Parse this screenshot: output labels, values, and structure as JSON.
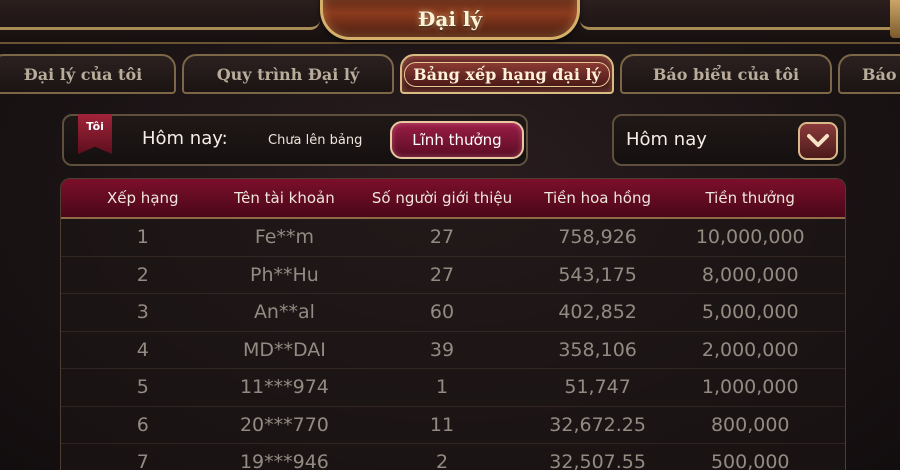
{
  "header": {
    "title": "Đại lý"
  },
  "tabs": [
    {
      "label": "Đại lý của tôi",
      "active": false
    },
    {
      "label": "Quy trình Đại lý",
      "active": false
    },
    {
      "label": "Bảng xếp hạng đại lý",
      "active": true
    },
    {
      "label": "Báo biểu của tôi",
      "active": false
    },
    {
      "label": "Báo",
      "active": false
    }
  ],
  "filter": {
    "badge": "Tôi",
    "today_label": "Hôm nay:",
    "status_text": "Chưa lên bảng",
    "claim_button": "Lĩnh thưởng",
    "period_select": "Hôm nay"
  },
  "table": {
    "headers": [
      "Xếp hạng",
      "Tên tài khoản",
      "Số người giới thiệu",
      "Tiền hoa hồng",
      "Tiền thưởng"
    ],
    "rows": [
      [
        "1",
        "Fe**m",
        "27",
        "758,926",
        "10,000,000"
      ],
      [
        "2",
        "Ph**Hu",
        "27",
        "543,175",
        "8,000,000"
      ],
      [
        "3",
        "An**al",
        "60",
        "402,852",
        "5,000,000"
      ],
      [
        "4",
        "MD**DAI",
        "39",
        "358,106",
        "2,000,000"
      ],
      [
        "5",
        "11***974",
        "1",
        "51,747",
        "1,000,000"
      ],
      [
        "6",
        "20***770",
        "11",
        "32,672.25",
        "800,000"
      ],
      [
        "7",
        "19***946",
        "2",
        "32,507.55",
        "500,000"
      ]
    ]
  },
  "colors": {
    "accent": "#8a0f2e",
    "gold_border": "#d4b06a",
    "row_text": "#938a82"
  }
}
